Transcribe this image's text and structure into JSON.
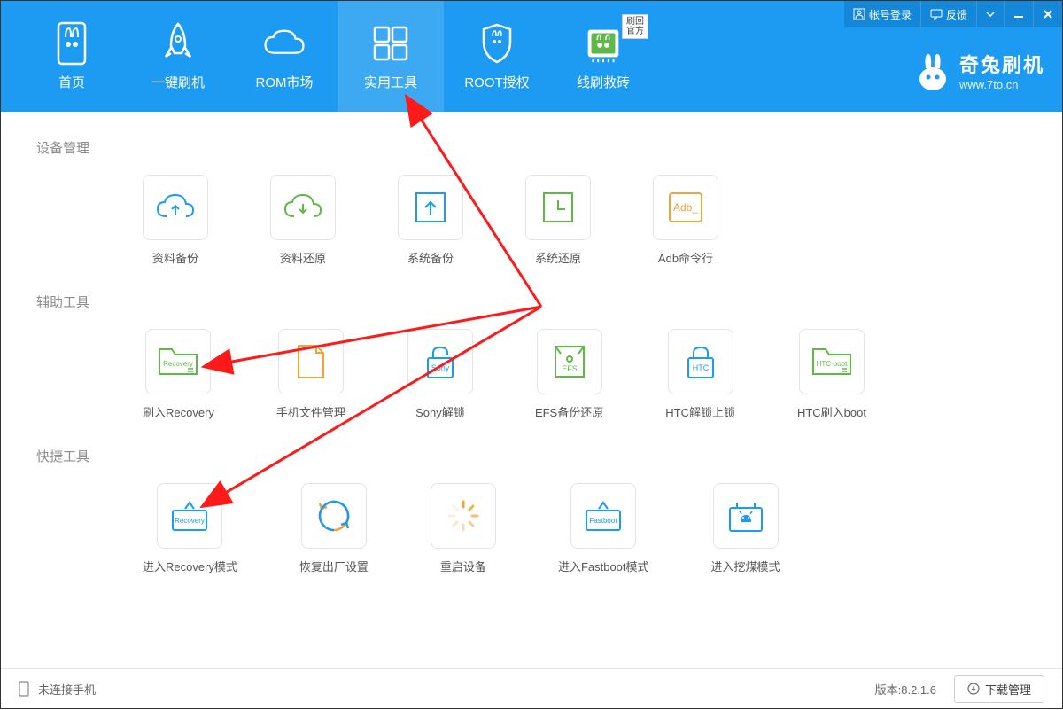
{
  "topbar": {
    "login": "帐号登录",
    "feedback": "反馈"
  },
  "brand": {
    "name": "奇兔刷机",
    "url": "www.7to.cn"
  },
  "nav": {
    "home": "首页",
    "flash": "一键刷机",
    "rom": "ROM市场",
    "tools": "实用工具",
    "root": "ROOT授权",
    "wire": "线刷救砖",
    "badge_l1": "刷回",
    "badge_l2": "官方"
  },
  "sections": {
    "device": {
      "title": "设备管理",
      "items": {
        "backup_data": "资料备份",
        "restore_data": "资料还原",
        "backup_sys": "系统备份",
        "restore_sys": "系统还原",
        "adb": "Adb命令行"
      }
    },
    "assist": {
      "title": "辅助工具",
      "items": {
        "flash_recovery": "刷入Recovery",
        "file_mgr": "手机文件管理",
        "sony": "Sony解锁",
        "efs": "EFS备份还原",
        "htc_lock": "HTC解锁上锁",
        "htc_boot": "HTC刷入boot"
      }
    },
    "quick": {
      "title": "快捷工具",
      "items": {
        "enter_recovery": "进入Recovery模式",
        "factory": "恢复出厂设置",
        "reboot": "重启设备",
        "fastboot": "进入Fastboot模式",
        "dig": "进入挖煤模式"
      }
    }
  },
  "footer": {
    "status": "未连接手机",
    "version": "版本:8.2.1.6",
    "download": "下载管理"
  },
  "icon_text": {
    "recovery": "Recovery",
    "sony": "Sony",
    "efs": "EFS",
    "htc": "HTC",
    "htcboot": "HTC-boot",
    "fastboot": "Fastboot",
    "adb": "Adb_"
  }
}
